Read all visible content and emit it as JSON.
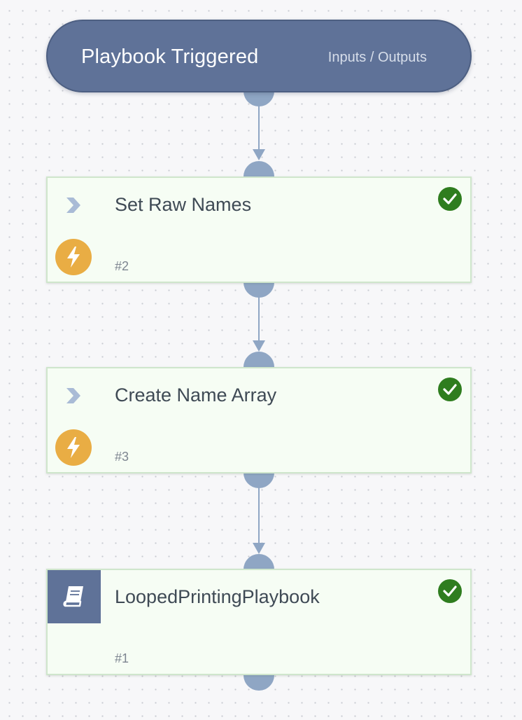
{
  "trigger": {
    "title": "Playbook Triggered",
    "io_label": "Inputs / Outputs"
  },
  "tasks": [
    {
      "title": "Set Raw Names",
      "id_label": "#2",
      "kind": "script",
      "kind_icon": "lightning-bolt-icon",
      "status": "completed",
      "status_icon": "checkmark-icon"
    },
    {
      "title": "Create Name Array",
      "id_label": "#3",
      "kind": "script",
      "kind_icon": "lightning-bolt-icon",
      "status": "completed",
      "status_icon": "checkmark-icon"
    },
    {
      "title": "LoopedPrintingPlaybook",
      "id_label": "#1",
      "kind": "sub-playbook",
      "kind_icon": "book-icon",
      "status": "completed",
      "status_icon": "checkmark-icon"
    }
  ],
  "colors": {
    "trigger_fill": "#5f7298",
    "connector": "#8fa6c4",
    "card_fill": "#f6fdf4",
    "card_border": "#cfe6cc",
    "bolt": "#e9ad44",
    "success": "#2f7d1f",
    "chevron": "#a9bbd6"
  }
}
